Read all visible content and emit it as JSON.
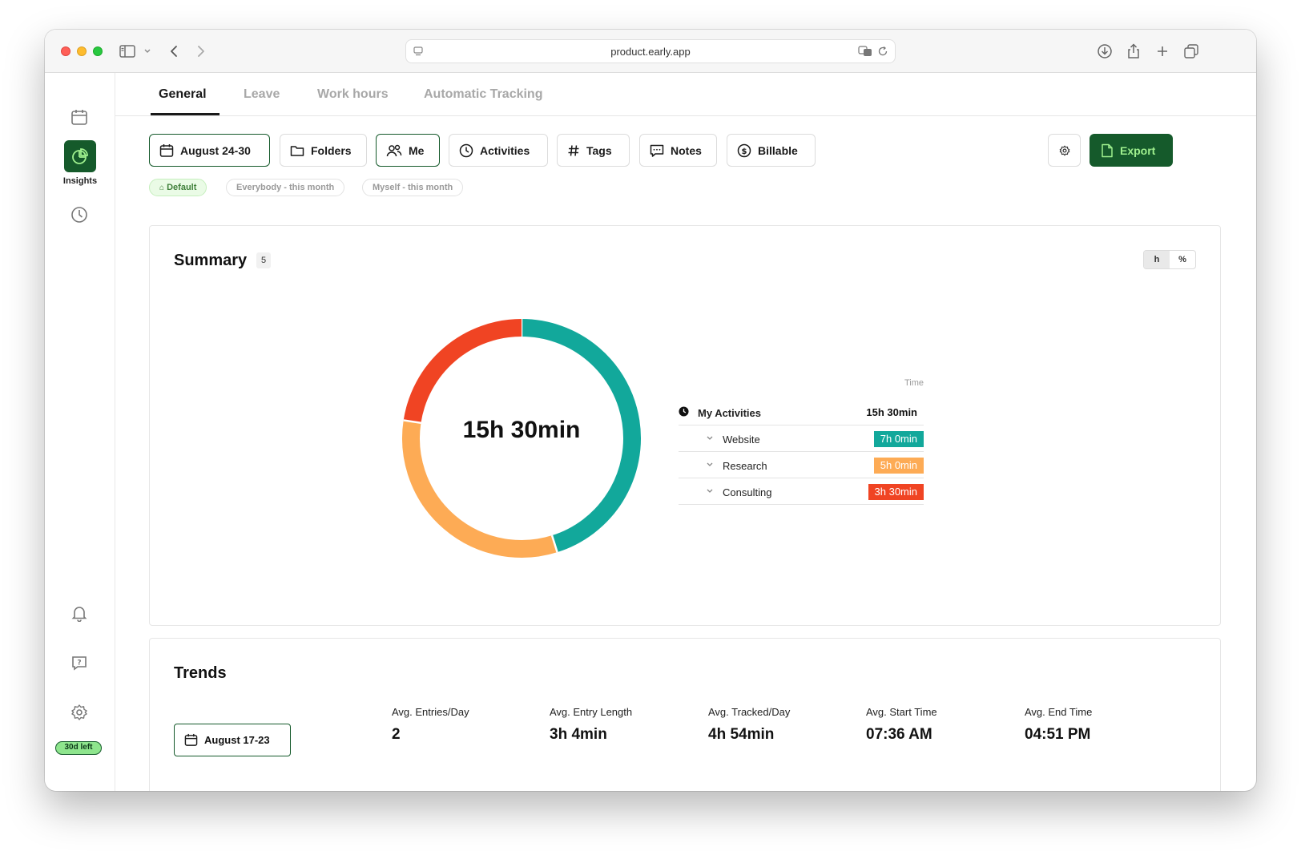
{
  "browser": {
    "url": "product.early.app"
  },
  "sidebar": {
    "active_label": "Insights",
    "trial_badge": "30d left"
  },
  "tabs": [
    {
      "label": "General",
      "active": true
    },
    {
      "label": "Leave",
      "active": false
    },
    {
      "label": "Work hours",
      "active": false
    },
    {
      "label": "Automatic Tracking",
      "active": false
    }
  ],
  "filters": {
    "date": "August 24-30",
    "folders": "Folders",
    "me": "Me",
    "activities": "Activities",
    "tags": "Tags",
    "notes": "Notes",
    "billable": "Billable",
    "export": "Export"
  },
  "presets": {
    "default": "Default",
    "everybody": "Everybody - this month",
    "myself": "Myself - this month"
  },
  "summary": {
    "title": "Summary",
    "count": "5",
    "unit_hours": "h",
    "unit_percent": "%",
    "total": "15h 30min",
    "legend_header": "Time",
    "group_name": "My Activities",
    "group_total": "15h 30min",
    "items": [
      {
        "name": "Website",
        "value": "7h 0min",
        "color": "#12a89b"
      },
      {
        "name": "Research",
        "value": "5h 0min",
        "color": "#fdab55"
      },
      {
        "name": "Consulting",
        "value": "3h 30min",
        "color": "#f04423"
      }
    ]
  },
  "chart_data": {
    "type": "pie",
    "categories": [
      "Website",
      "Research",
      "Consulting"
    ],
    "values": [
      7,
      5,
      3.5
    ],
    "colors": [
      "#12a89b",
      "#fdab55",
      "#f04423"
    ]
  },
  "trends": {
    "title": "Trends",
    "date": "August 17-23",
    "metrics": [
      {
        "label": "Avg. Entries/Day",
        "value": "2"
      },
      {
        "label": "Avg. Entry Length",
        "value": "3h 4min"
      },
      {
        "label": "Avg. Tracked/Day",
        "value": "4h 54min"
      },
      {
        "label": "Avg. Start Time",
        "value": "07:36 AM"
      },
      {
        "label": "Avg. End Time",
        "value": "04:51 PM"
      }
    ]
  },
  "colors": {
    "brand": "#155a2b",
    "brand_accent": "#9ff08e"
  }
}
